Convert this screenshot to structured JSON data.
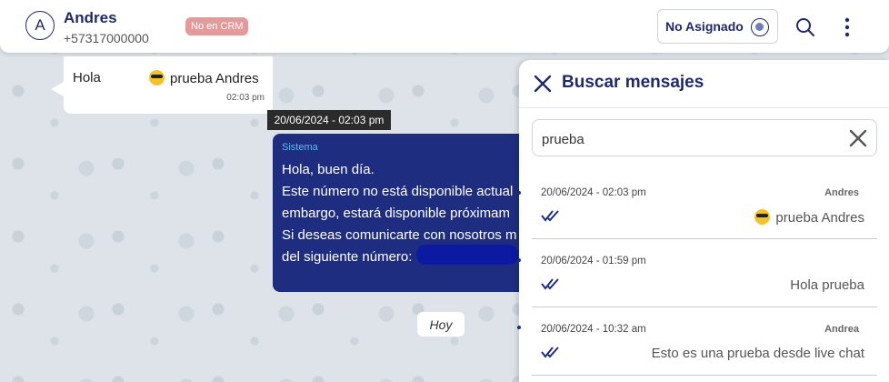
{
  "header": {
    "avatar_initial": "A",
    "contact_name": "Andres",
    "contact_phone": "+57317000000",
    "crm_badge": "No en CRM",
    "assign_label": "No Asignado"
  },
  "chat": {
    "incoming": {
      "text_left": "Hola",
      "text_right": "prueba Andres",
      "time": "02:03 pm"
    },
    "tooltip_date": "20/06/2024 - 02:03 pm",
    "outgoing": {
      "sender": "Sistema",
      "body": "Hola, buen día.\nEste número no está disponible actual\nembargo, estará disponible próximam\nSi deseas comunicarte con nosotros m\ndel siguiente número:"
    },
    "day_chip": "Hoy"
  },
  "search_panel": {
    "title": "Buscar mensajes",
    "query": "prueba",
    "results": [
      {
        "date": "20/06/2024 - 02:03 pm",
        "sender": "Andres",
        "text": "prueba Andres",
        "has_emoji": true
      },
      {
        "date": "20/06/2024 - 01:59 pm",
        "sender": "",
        "text": "Hola prueba",
        "has_emoji": false
      },
      {
        "date": "20/06/2024 - 10:32 am",
        "sender": "Andrea",
        "text": "Esto es una prueba desde live chat",
        "has_emoji": false
      }
    ]
  },
  "colors": {
    "brand_navy": "#1f2a6b",
    "outgoing_bubble": "#1f2d80",
    "crm_badge_bg": "#e29a9a",
    "sender_label": "#5fb7f5"
  },
  "icons": {
    "search": "search-icon",
    "menu": "vertical-dots-icon",
    "close": "close-icon",
    "clear": "clear-icon",
    "ticks": "double-check-icon",
    "assign": "agent-icon",
    "emoji": "sunglasses-emoji-icon"
  }
}
